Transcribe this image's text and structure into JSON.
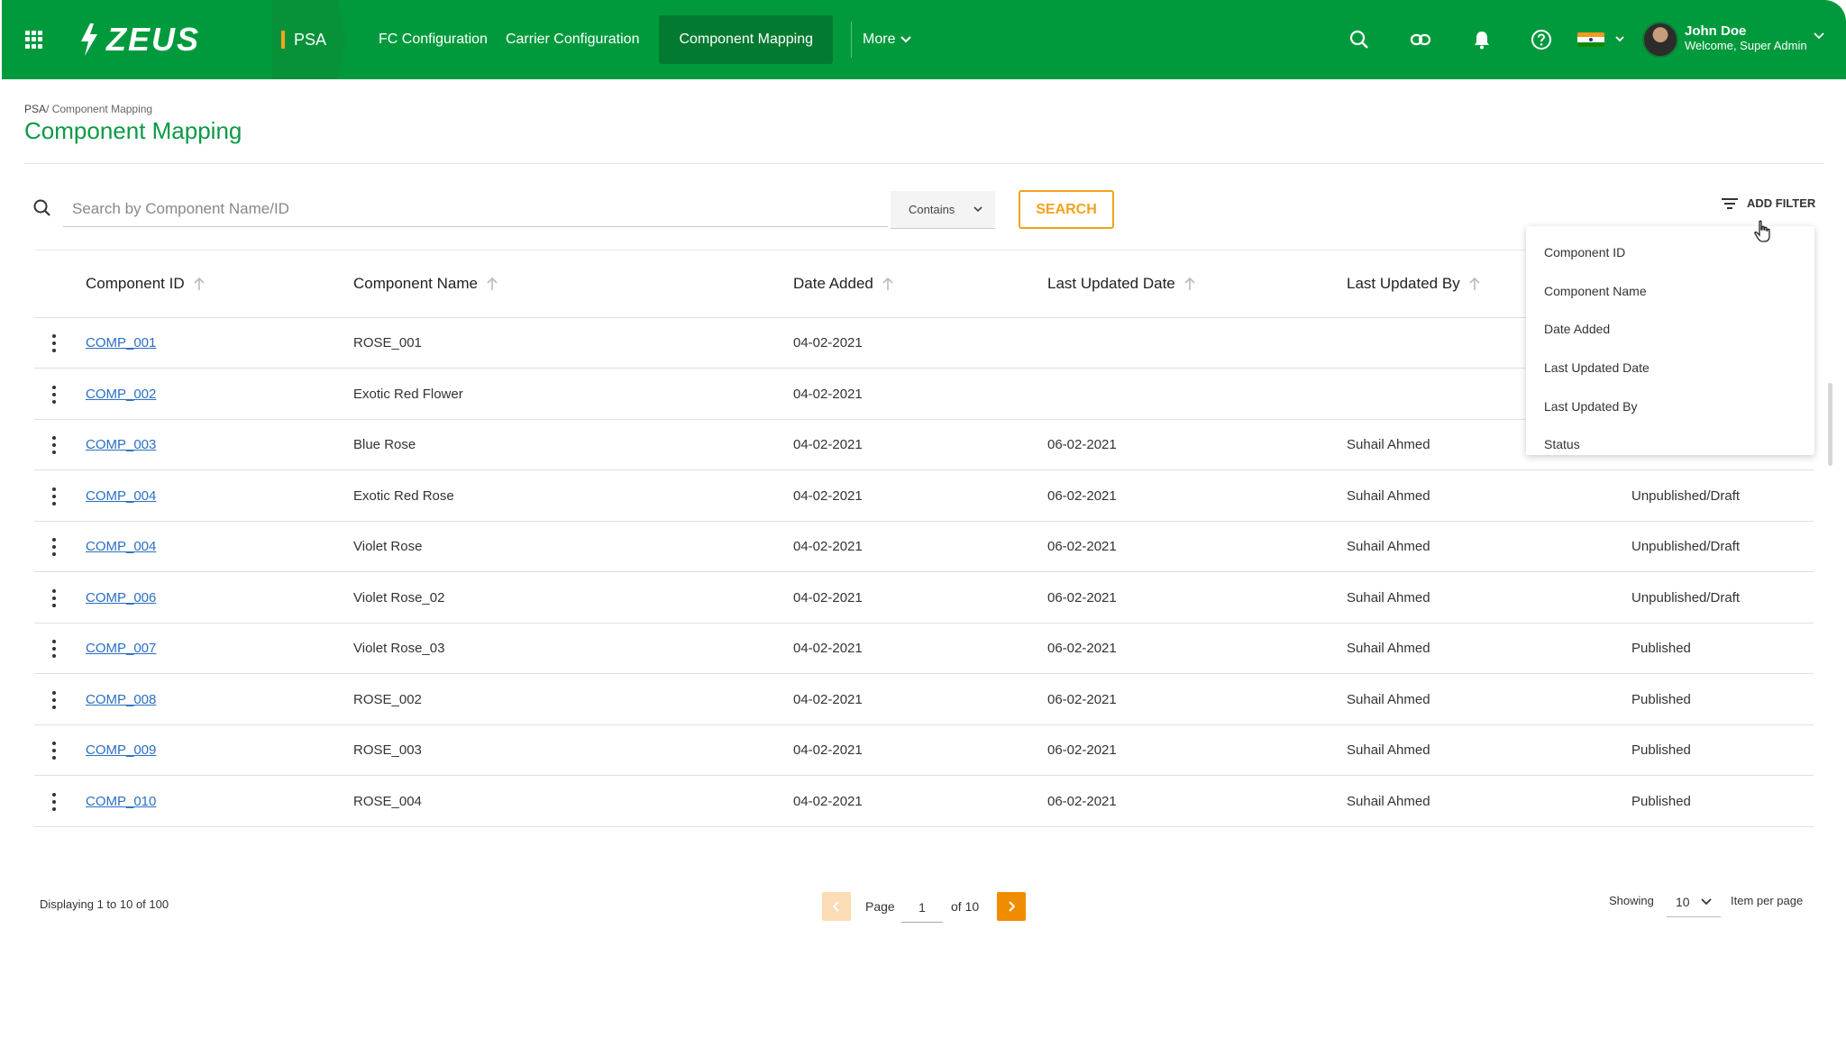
{
  "app": {
    "logo": "ZEUS",
    "module": "PSA"
  },
  "nav": {
    "items": [
      "FC Configuration",
      "Carrier Configuration",
      "Component Mapping"
    ],
    "active_index": 2,
    "more": "More"
  },
  "user": {
    "name": "John Doe",
    "subtitle": "Welcome, Super Admin"
  },
  "breadcrumb": {
    "root": "PSA",
    "separator": "/",
    "current": "Component Mapping"
  },
  "page_title": "Component Mapping",
  "search": {
    "placeholder": "Search by Component Name/ID",
    "value": "",
    "match_mode": "Contains",
    "button": "SEARCH"
  },
  "filter": {
    "label": "ADD FILTER",
    "options": [
      "Component ID",
      "Component Name",
      "Date Added",
      "Last Updated Date",
      "Last Updated By",
      "Status"
    ]
  },
  "table": {
    "columns": [
      "Component ID",
      "Component Name",
      "Date Added",
      "Last Updated Date",
      "Last Updated By"
    ],
    "rows": [
      {
        "id": "COMP_001",
        "name": "ROSE_001",
        "added": "04-02-2021",
        "updated": "",
        "by": "",
        "status": ""
      },
      {
        "id": "COMP_002",
        "name": "Exotic Red Flower",
        "added": "04-02-2021",
        "updated": "",
        "by": "",
        "status": ""
      },
      {
        "id": "COMP_003",
        "name": "Blue Rose",
        "added": "04-02-2021",
        "updated": "06-02-2021",
        "by": "Suhail Ahmed",
        "status": ""
      },
      {
        "id": "COMP_004",
        "name": "Exotic Red Rose",
        "added": "04-02-2021",
        "updated": "06-02-2021",
        "by": "Suhail Ahmed",
        "status": "Unpublished/Draft"
      },
      {
        "id": "COMP_004",
        "name": "Violet Rose",
        "added": "04-02-2021",
        "updated": "06-02-2021",
        "by": "Suhail Ahmed",
        "status": "Unpublished/Draft"
      },
      {
        "id": "COMP_006",
        "name": "Violet Rose_02",
        "added": "04-02-2021",
        "updated": "06-02-2021",
        "by": "Suhail Ahmed",
        "status": "Unpublished/Draft"
      },
      {
        "id": "COMP_007",
        "name": "Violet Rose_03",
        "added": "04-02-2021",
        "updated": "06-02-2021",
        "by": "Suhail Ahmed",
        "status": "Published"
      },
      {
        "id": "COMP_008",
        "name": "ROSE_002",
        "added": "04-02-2021",
        "updated": "06-02-2021",
        "by": "Suhail Ahmed",
        "status": "Published"
      },
      {
        "id": "COMP_009",
        "name": "ROSE_003",
        "added": "04-02-2021",
        "updated": "06-02-2021",
        "by": "Suhail Ahmed",
        "status": "Published"
      },
      {
        "id": "COMP_010",
        "name": "ROSE_004",
        "added": "04-02-2021",
        "updated": "06-02-2021",
        "by": "Suhail Ahmed",
        "status": "Published"
      }
    ]
  },
  "pagination": {
    "display": "Displaying 1 to 10 of 100",
    "page_label": "Page",
    "current_page": "1",
    "of_label": "of",
    "total_pages": "10",
    "showing_label": "Showing",
    "per_page": "10",
    "per_page_label": "Item per page"
  },
  "icons": {
    "apps": "apps-grid-icon",
    "search": "search-icon",
    "link": "link-icon",
    "bell": "bell-icon",
    "help": "help-icon",
    "flag": "india-flag-icon",
    "filter": "filter-icon",
    "kebab": "more-vertical-icon"
  },
  "colors": {
    "header": "#009a3d",
    "title": "#0b9a45",
    "accent": "#f4a11c",
    "link": "#2a6fc4",
    "next": "#f08c00",
    "prev": "#fbdcb4"
  }
}
